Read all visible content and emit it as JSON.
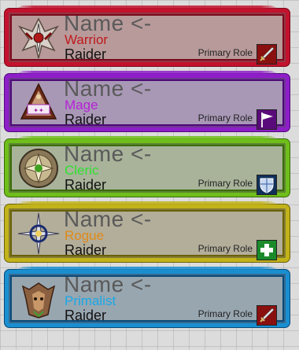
{
  "cards": [
    {
      "name": "Name <-",
      "class_name": "Warrior",
      "class_color": "#c0181c",
      "rank": "Raider",
      "role_label": "Primary Role",
      "role_icon": "sword-icon",
      "emblem": "warrior-emblem-icon",
      "frame_color": "#c2122e",
      "fill_color": "#b89a9a"
    },
    {
      "name": "Name <-",
      "class_name": "Mage",
      "class_color": "#b820d8",
      "rank": "Raider",
      "role_label": "Primary Role",
      "role_icon": "flag-icon",
      "emblem": "mage-emblem-icon",
      "frame_color": "#8e1ec8",
      "fill_color": "#a898b6"
    },
    {
      "name": "Name <-",
      "class_name": "Cleric",
      "class_color": "#30e030",
      "rank": "Raider",
      "role_label": "Primary Role",
      "role_icon": "shield-icon",
      "emblem": "cleric-emblem-icon",
      "frame_color": "#6fbe1a",
      "fill_color": "#a8b39a"
    },
    {
      "name": "Name <-",
      "class_name": "Rogue",
      "class_color": "#e08a18",
      "rank": "Raider",
      "role_label": "Primary Role",
      "role_icon": "healer-cross-icon",
      "emblem": "rogue-emblem-icon",
      "frame_color": "#c2b31a",
      "fill_color": "#b3ae9a"
    },
    {
      "name": "Name <-",
      "class_name": "Primalist",
      "class_color": "#18a8e8",
      "rank": "Raider",
      "role_label": "Primary Role",
      "role_icon": "sword-icon",
      "emblem": "primalist-emblem-icon",
      "frame_color": "#1a8fd0",
      "fill_color": "#98a6b0"
    }
  ]
}
